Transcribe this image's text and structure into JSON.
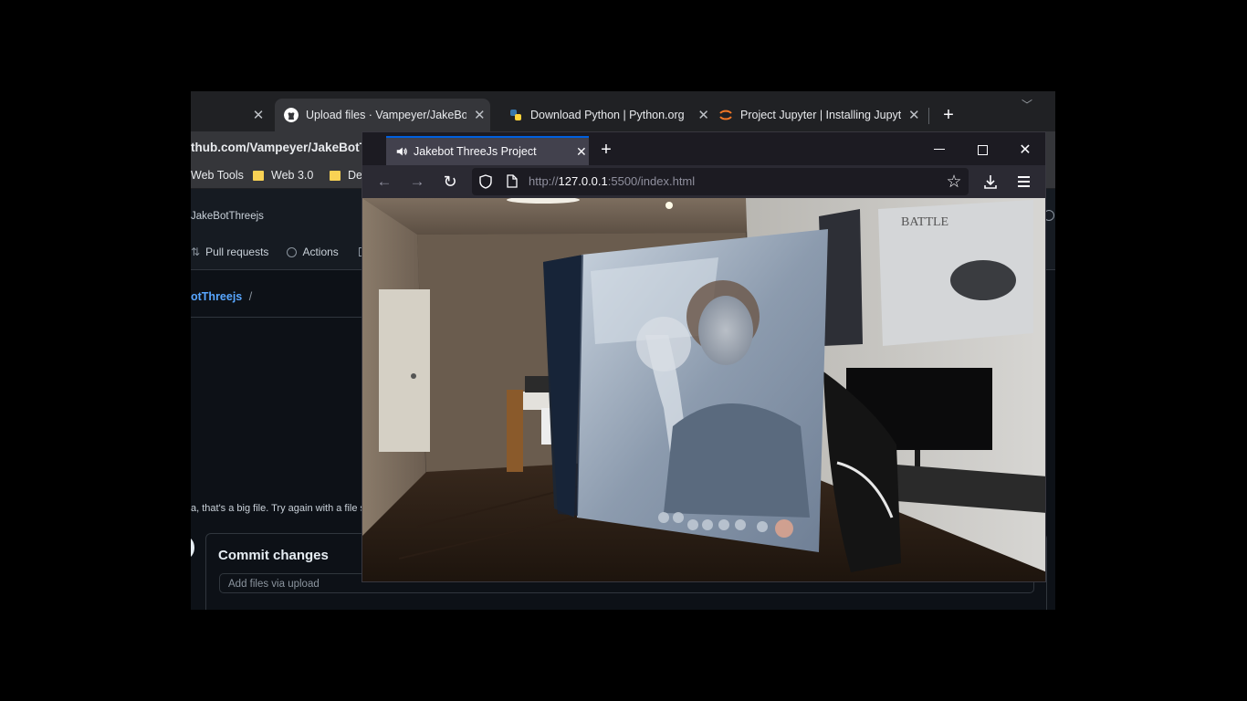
{
  "back_browser": {
    "tabs": [
      {
        "title": "Upload files · Vampeyer/JakeBotT",
        "icon": "github-icon"
      },
      {
        "title": "Download Python | Python.org",
        "icon": "python-icon"
      },
      {
        "title": "Project Jupyter | Installing Jupyte",
        "icon": "jupyter-icon"
      }
    ],
    "url_fragment": "thub.com/Vampeyer/JakeBotThr",
    "bookmarks": [
      "Web Tools",
      "Web 3.0",
      "De"
    ],
    "repo_name": "JakeBotThreejs",
    "nav": {
      "pull_requests": "Pull requests",
      "actions": "Actions"
    },
    "breadcrumb_repo": "otThreejs",
    "breadcrumb_sep": "/",
    "error_message": "a, that's a big file. Try again with a file s",
    "commit_title": "Commit changes",
    "commit_placeholder": "Add files via upload"
  },
  "front_browser": {
    "tab_title": "Jakebot ThreeJs Project",
    "url": {
      "prefix": "http://",
      "host": "127.0.0.1",
      "rest": ":5500/index.html"
    }
  },
  "colors": {
    "chrome_dark": "#202124",
    "github_bg": "#0d1117",
    "firefox_bg": "#1c1b22",
    "firefox_toolbar": "#2b2a33",
    "link_blue": "#58a6ff",
    "tab_accent": "#0060df"
  }
}
